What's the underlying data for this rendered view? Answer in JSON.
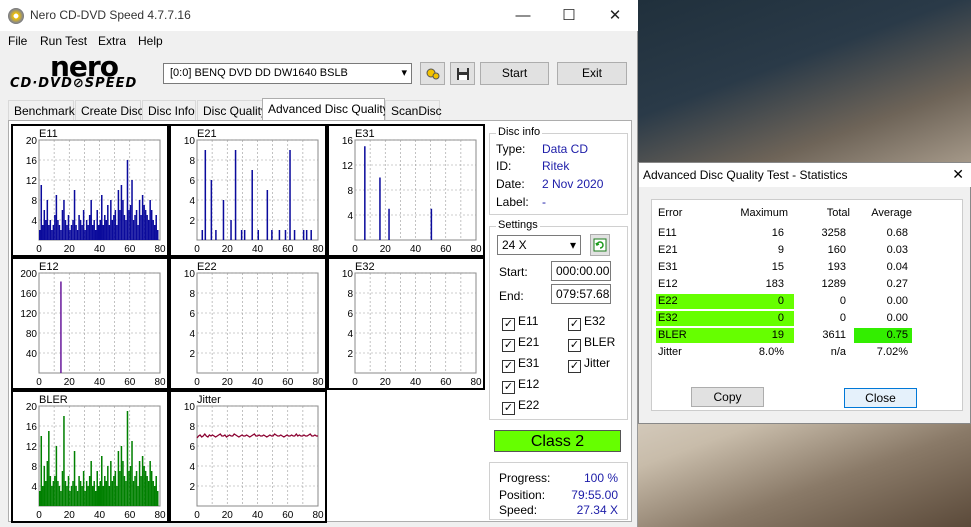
{
  "window": {
    "title": "Nero CD-DVD Speed 4.7.7.16",
    "minimize": "—",
    "maximize": "☐",
    "close": "✕"
  },
  "menu": [
    "File",
    "Run Test",
    "Extra",
    "Help"
  ],
  "logo": {
    "brand": "nero",
    "sub": "CD·DVD⊘SPEED"
  },
  "toolbar": {
    "drive": "[0:0]  BENQ DVD DD DW1640 BSLB",
    "start": "Start",
    "exit": "Exit"
  },
  "tabs": [
    "Benchmark",
    "Create Disc",
    "Disc Info",
    "Disc Quality",
    "Advanced Disc Quality",
    "ScanDisc"
  ],
  "disc_info": {
    "title": "Disc info",
    "type_label": "Type:",
    "type": "Data CD",
    "id_label": "ID:",
    "id": "Ritek",
    "date_label": "Date:",
    "date": "2 Nov 2020",
    "label_label": "Label:",
    "label": "-"
  },
  "settings": {
    "title": "Settings",
    "speed": "24 X",
    "start_label": "Start:",
    "start": "000:00.00",
    "end_label": "End:",
    "end": "079:57.68",
    "checks": [
      "E11",
      "E32",
      "E21",
      "BLER",
      "E31",
      "Jitter",
      "E12",
      "E22"
    ]
  },
  "result": {
    "class": "Class 2"
  },
  "progress": {
    "progress_label": "Progress:",
    "progress": "100 %",
    "position_label": "Position:",
    "position": "79:55.00",
    "speed_label": "Speed:",
    "speed": "27.34 X"
  },
  "stats_dialog": {
    "title": "Advanced Disc Quality Test - Statistics",
    "headers": [
      "Error",
      "Maximum",
      "Total",
      "Average"
    ],
    "rows": [
      {
        "error": "E11",
        "max": "16",
        "total": "3258",
        "avg": "0.68"
      },
      {
        "error": "E21",
        "max": "9",
        "total": "160",
        "avg": "0.03"
      },
      {
        "error": "E31",
        "max": "15",
        "total": "193",
        "avg": "0.04"
      },
      {
        "error": "E12",
        "max": "183",
        "total": "1289",
        "avg": "0.27"
      },
      {
        "error": "E22",
        "max": "0",
        "total": "0",
        "avg": "0.00"
      },
      {
        "error": "E32",
        "max": "0",
        "total": "0",
        "avg": "0.00"
      },
      {
        "error": "BLER",
        "max": "19",
        "total": "3611",
        "avg": "0.75"
      },
      {
        "error": "Jitter",
        "max": "8.0%",
        "total": "n/a",
        "avg": "7.02%"
      }
    ],
    "copy": "Copy",
    "close": "Close"
  },
  "colors": {
    "bar_blue": "#0a0a9c",
    "bar_purple": "#6a1a9c",
    "bar_green": "#008000",
    "jitter": "#8b0030",
    "highlight": "#66ff00",
    "avg_highlight": "#33ee00"
  },
  "chart_data": [
    {
      "type": "bar",
      "label": "E11",
      "x_ticks": [
        "0",
        "20",
        "40",
        "60",
        "80"
      ],
      "y_ticks": [
        "20",
        "16",
        "12",
        "8",
        "4"
      ],
      "ylim": [
        0,
        20
      ],
      "xlim": [
        0,
        80
      ],
      "values": [
        2,
        11,
        3,
        6,
        4,
        8,
        3,
        4,
        2,
        3,
        5,
        9,
        4,
        3,
        2,
        6,
        8,
        4,
        3,
        5,
        2,
        3,
        4,
        10,
        3,
        2,
        5,
        4,
        3,
        6,
        2,
        4,
        3,
        5,
        8,
        3,
        4,
        2,
        6,
        3,
        4,
        9,
        3,
        5,
        4,
        7,
        3,
        8,
        4,
        5,
        6,
        3,
        10,
        6,
        11,
        8,
        5,
        4,
        16,
        6,
        7,
        12,
        4,
        5,
        6,
        3,
        8,
        5,
        9,
        7,
        6,
        5,
        4,
        8,
        6,
        4,
        3,
        5,
        2
      ]
    },
    {
      "type": "bar",
      "label": "E21",
      "x_ticks": [
        "0",
        "20",
        "40",
        "60",
        "80"
      ],
      "y_ticks": [
        "10",
        "8",
        "6",
        "4",
        "2"
      ],
      "ylim": [
        0,
        10
      ],
      "xlim": [
        0,
        80
      ],
      "values": [
        0,
        0,
        0,
        1,
        0,
        9,
        0,
        0,
        0,
        6,
        0,
        0,
        1,
        0,
        0,
        0,
        0,
        4,
        0,
        0,
        0,
        0,
        2,
        0,
        0,
        9,
        0,
        0,
        0,
        1,
        0,
        1,
        0,
        0,
        0,
        0,
        7,
        0,
        0,
        0,
        1,
        0,
        0,
        0,
        0,
        0,
        5,
        0,
        0,
        1,
        0,
        0,
        0,
        0,
        1,
        0,
        0,
        0,
        1,
        0,
        0,
        9,
        0,
        0,
        1,
        0,
        0,
        0,
        0,
        0,
        1,
        0,
        1,
        0,
        0,
        1,
        0,
        0,
        0
      ]
    },
    {
      "type": "bar",
      "label": "E31",
      "x_ticks": [
        "0",
        "20",
        "40",
        "60",
        "80"
      ],
      "y_ticks": [
        "16",
        "12",
        "8",
        "4"
      ],
      "ylim": [
        0,
        16
      ],
      "xlim": [
        0,
        80
      ],
      "values": [
        0,
        0,
        0,
        0,
        0,
        0,
        15,
        0,
        0,
        0,
        0,
        0,
        0,
        0,
        0,
        0,
        10,
        0,
        0,
        0,
        0,
        0,
        5,
        0,
        0,
        0,
        0,
        0,
        0,
        0,
        0,
        0,
        0,
        0,
        0,
        0,
        0,
        0,
        0,
        0,
        0,
        0,
        0,
        0,
        0,
        0,
        0,
        0,
        0,
        0,
        5,
        0,
        0,
        0,
        0,
        0,
        0,
        0,
        0,
        0,
        0,
        0,
        0,
        0,
        0,
        0,
        0,
        0,
        0,
        0,
        0,
        0,
        0,
        0,
        0,
        0,
        0,
        0,
        0
      ]
    },
    {
      "type": "bar",
      "label": "E12",
      "x_ticks": [
        "0",
        "20",
        "40",
        "60",
        "80"
      ],
      "y_ticks": [
        "200",
        "160",
        "120",
        "80",
        "40"
      ],
      "ylim": [
        0,
        200
      ],
      "xlim": [
        0,
        80
      ],
      "values": [
        0,
        0,
        0,
        0,
        0,
        0,
        0,
        0,
        0,
        0,
        0,
        0,
        0,
        0,
        183,
        0,
        0,
        0,
        0,
        0,
        0,
        0,
        0,
        0,
        0,
        0,
        0,
        0,
        0,
        0,
        0,
        0,
        0,
        0,
        0,
        0,
        0,
        0,
        0,
        0,
        0,
        0,
        0,
        0,
        0,
        0,
        0,
        0,
        0,
        0,
        0,
        0,
        0,
        0,
        0,
        0,
        0,
        0,
        0,
        0,
        0,
        0,
        0,
        0,
        0,
        0,
        0,
        0,
        0,
        0,
        0,
        0,
        0,
        0,
        0,
        0,
        0,
        0,
        0
      ]
    },
    {
      "type": "bar",
      "label": "E22",
      "x_ticks": [
        "0",
        "20",
        "40",
        "60",
        "80"
      ],
      "y_ticks": [
        "10",
        "8",
        "6",
        "4",
        "2"
      ],
      "ylim": [
        0,
        10
      ],
      "xlim": [
        0,
        80
      ],
      "values": []
    },
    {
      "type": "bar",
      "label": "E32",
      "x_ticks": [
        "0",
        "20",
        "40",
        "60",
        "80"
      ],
      "y_ticks": [
        "10",
        "8",
        "6",
        "4",
        "2"
      ],
      "ylim": [
        0,
        10
      ],
      "xlim": [
        0,
        80
      ],
      "values": []
    },
    {
      "type": "bar",
      "label": "BLER",
      "x_ticks": [
        "0",
        "20",
        "40",
        "60",
        "80"
      ],
      "y_ticks": [
        "20",
        "16",
        "12",
        "8",
        "4"
      ],
      "ylim": [
        0,
        20
      ],
      "xlim": [
        0,
        80
      ],
      "values": [
        3,
        14,
        4,
        8,
        5,
        9,
        15,
        6,
        4,
        5,
        6,
        12,
        5,
        4,
        3,
        7,
        18,
        5,
        4,
        6,
        3,
        4,
        5,
        11,
        4,
        3,
        6,
        5,
        4,
        7,
        3,
        5,
        4,
        6,
        9,
        4,
        5,
        3,
        7,
        4,
        5,
        10,
        4,
        6,
        5,
        8,
        4,
        9,
        5,
        6,
        7,
        4,
        11,
        7,
        12,
        9,
        6,
        5,
        19,
        7,
        8,
        13,
        5,
        6,
        7,
        4,
        9,
        6,
        10,
        8,
        7,
        6,
        5,
        9,
        7,
        5,
        4,
        6,
        3
      ]
    },
    {
      "type": "line",
      "label": "Jitter",
      "x_ticks": [
        "0",
        "20",
        "40",
        "60",
        "80"
      ],
      "y_ticks": [
        "10",
        "8",
        "6",
        "4",
        "2"
      ],
      "ylim": [
        0,
        10
      ],
      "xlim": [
        0,
        80
      ],
      "values": [
        6.8,
        7.0,
        7.1,
        6.9,
        7.0,
        7.2,
        7.0,
        6.9,
        7.1,
        7.0,
        7.1,
        7.0,
        6.9,
        7.0,
        7.1,
        7.2,
        7.0,
        7.0,
        7.1,
        6.9,
        7.0,
        7.1,
        7.0,
        7.0,
        7.2,
        7.1,
        7.0,
        6.9,
        7.0,
        7.1,
        7.0,
        7.0,
        7.1,
        7.0,
        6.9,
        7.0,
        7.1,
        7.2,
        7.0,
        7.0,
        7.1,
        7.0,
        7.0,
        7.1,
        7.0,
        6.9,
        7.0,
        7.1,
        7.0,
        7.0,
        7.2,
        7.1,
        7.0,
        7.0,
        7.1,
        7.0,
        6.9,
        7.0,
        7.1,
        7.0,
        7.0,
        7.1,
        7.0,
        7.0,
        7.2,
        7.0,
        7.1,
        7.0,
        7.0,
        7.1,
        7.0,
        7.0,
        7.1,
        7.2,
        7.0,
        7.0,
        7.1,
        7.0,
        7.0
      ]
    }
  ]
}
